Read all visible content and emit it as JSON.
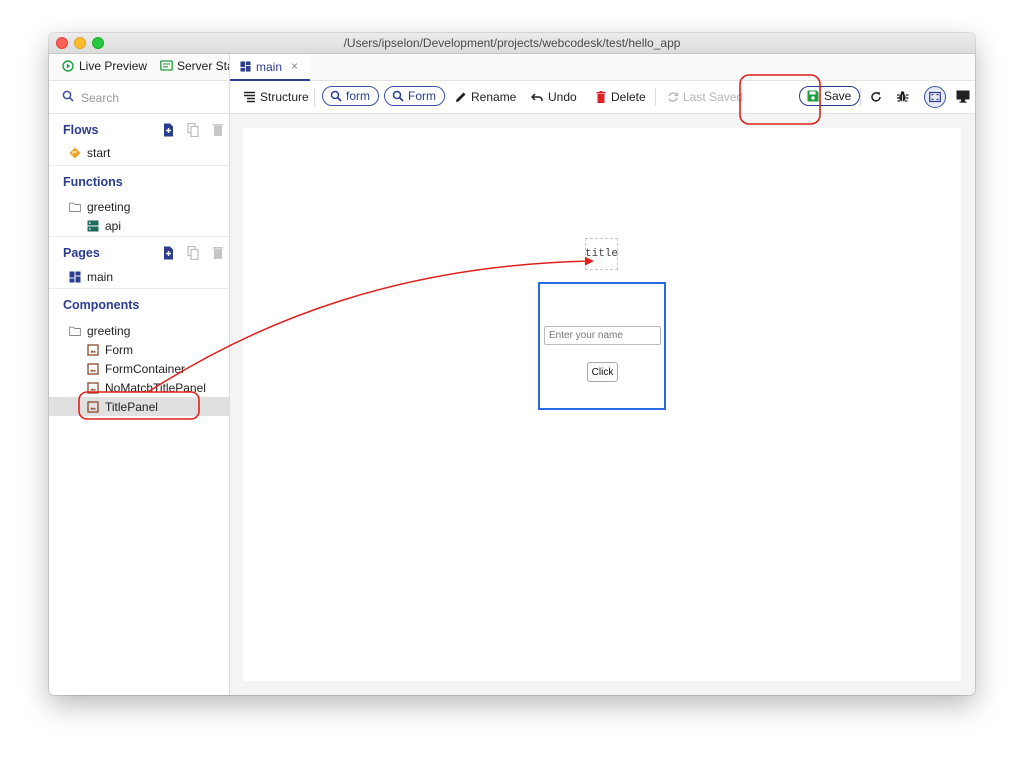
{
  "window": {
    "title": "/Users/ipselon/Development/projects/webcodesk/test/hello_app"
  },
  "sidebar": {
    "tabs": [
      {
        "label": "Live Preview"
      },
      {
        "label": "Server Sta"
      }
    ],
    "search": {
      "placeholder": "Search"
    },
    "sections": {
      "flows": {
        "title": "Flows",
        "items": [
          {
            "label": "start"
          }
        ]
      },
      "functions": {
        "title": "Functions",
        "folder": "greeting",
        "items": [
          {
            "label": "api"
          }
        ]
      },
      "pages": {
        "title": "Pages",
        "items": [
          {
            "label": "main"
          }
        ]
      },
      "components": {
        "title": "Components",
        "folder": "greeting",
        "items": [
          {
            "label": "Form"
          },
          {
            "label": "FormContainer"
          },
          {
            "label": "NoMatchTitlePanel"
          },
          {
            "label": "TitlePanel"
          }
        ]
      }
    }
  },
  "editor": {
    "tab": {
      "label": "main"
    },
    "toolbar": {
      "structure": "Structure",
      "search_form_lower": "form",
      "search_form_upper": "Form",
      "rename": "Rename",
      "undo": "Undo",
      "delete": "Delete",
      "last_saved": "Last Saved",
      "save": "Save"
    },
    "canvas": {
      "title_placeholder": "title",
      "name_input_placeholder": "Enter your name",
      "click_button": "Click"
    }
  },
  "colors": {
    "accent": "#2b3d8f",
    "annotation": "#e0201c",
    "save_icon": "#1e9e3e",
    "delete_icon": "#e02020",
    "flow_icon": "#f2a024",
    "selection_border": "#2a6ae0"
  }
}
